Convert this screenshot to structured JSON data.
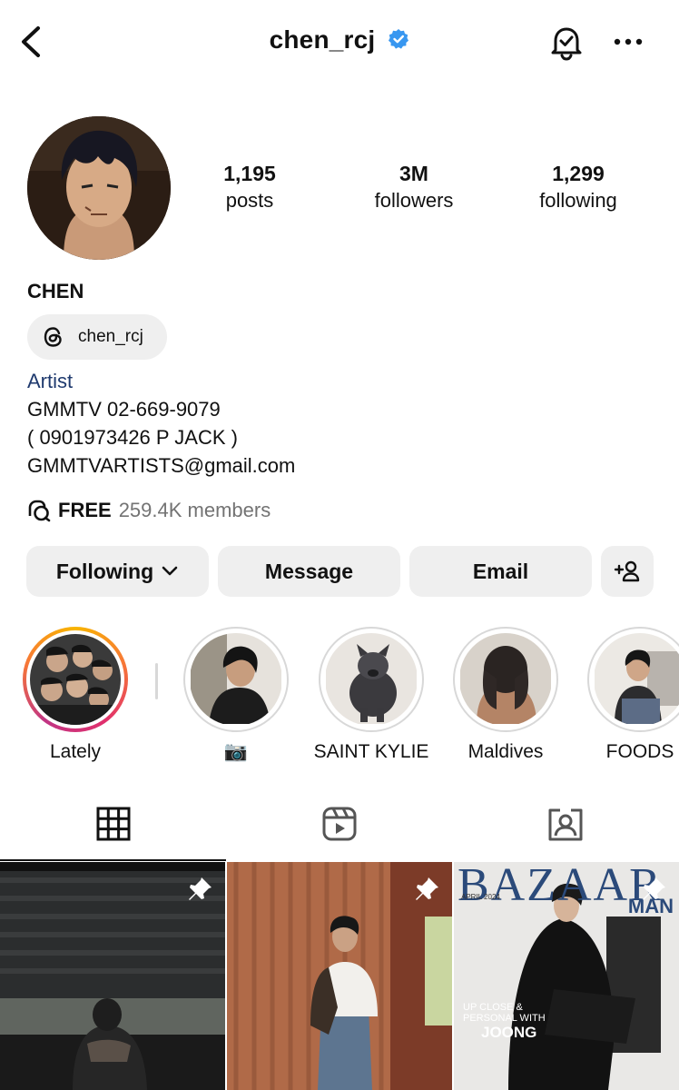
{
  "header": {
    "username": "chen_rcj",
    "icons": [
      "back-arrow-icon",
      "verified-badge-icon",
      "bell-check-icon",
      "more-dots-icon"
    ]
  },
  "stats": {
    "posts_count": "1,195",
    "posts_label": "posts",
    "followers_count": "3M",
    "followers_label": "followers",
    "following_count": "1,299",
    "following_label": "following"
  },
  "profile": {
    "name": "CHEN",
    "threads_handle": "chen_rcj",
    "category": "Artist",
    "bio_lines": [
      "GMMTV 02-669-9079",
      "( 0901973426 P JACK )",
      "GMMTVARTISTS@gmail.com"
    ]
  },
  "channel": {
    "label": "FREE",
    "members": "259.4K members"
  },
  "actions": {
    "following": "Following",
    "message": "Message",
    "email": "Email"
  },
  "highlights": [
    {
      "label": "Lately"
    },
    {
      "label": "📷"
    },
    {
      "label": "SAINT KYLIE"
    },
    {
      "label": "Maldives"
    },
    {
      "label": "FOODS"
    }
  ],
  "posts": {
    "post3_masthead": "BAZAAR",
    "post3_sub": "MAN",
    "post3_date": "APRIL 2024",
    "post3_tag1": "UP CLOSE &",
    "post3_tag2": "PERSONAL WITH",
    "post3_name": "JOONG"
  },
  "colors": {
    "verified": "#3897f0",
    "category_link": "#1f3a6e",
    "button_bg": "#efefef",
    "muted_text": "#737373"
  }
}
